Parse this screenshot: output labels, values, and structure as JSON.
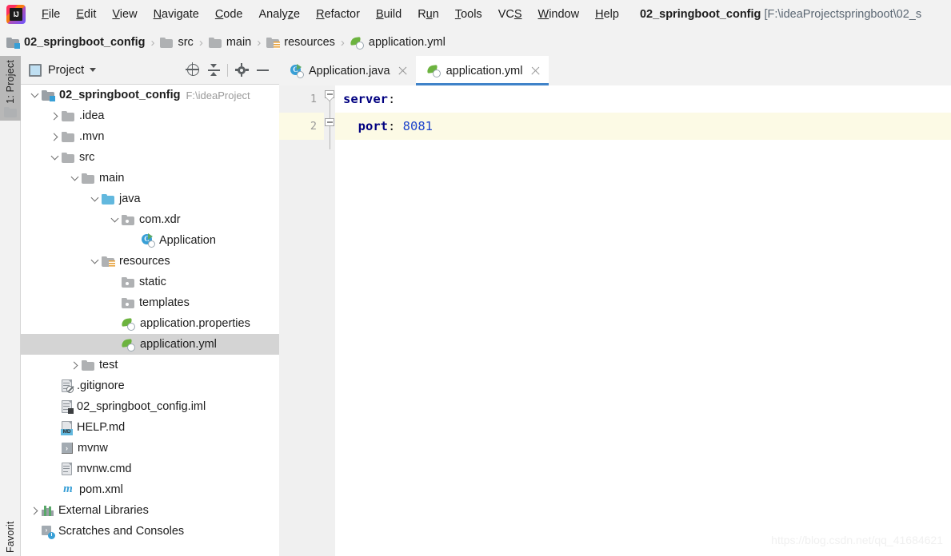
{
  "window": {
    "title_name": "02_springboot_config",
    "title_path": "[F:\\ideaProjectspringboot\\02_s",
    "logo_icon": "intellij-idea-logo"
  },
  "menubar": {
    "items": [
      {
        "label": "File",
        "mnemonic": "F"
      },
      {
        "label": "Edit",
        "mnemonic": "E"
      },
      {
        "label": "View",
        "mnemonic": "V"
      },
      {
        "label": "Navigate",
        "mnemonic": "N"
      },
      {
        "label": "Code",
        "mnemonic": "C"
      },
      {
        "label": "Analyze",
        "mnemonic": "z"
      },
      {
        "label": "Refactor",
        "mnemonic": "R"
      },
      {
        "label": "Build",
        "mnemonic": "B"
      },
      {
        "label": "Run",
        "mnemonic": "u"
      },
      {
        "label": "Tools",
        "mnemonic": "T"
      },
      {
        "label": "VCS",
        "mnemonic": "S"
      },
      {
        "label": "Window",
        "mnemonic": "W"
      },
      {
        "label": "Help",
        "mnemonic": "H"
      }
    ]
  },
  "breadcrumb": {
    "items": [
      {
        "label": "02_springboot_config",
        "icon": "module-folder-icon",
        "bold": true
      },
      {
        "label": "src",
        "icon": "folder-icon",
        "bold": false
      },
      {
        "label": "main",
        "icon": "folder-icon",
        "bold": false
      },
      {
        "label": "resources",
        "icon": "resources-folder-icon",
        "bold": false
      },
      {
        "label": "application.yml",
        "icon": "yml-file-icon",
        "bold": false
      }
    ],
    "separator": "›"
  },
  "toolstrip": {
    "project_label": "1: Project",
    "project_icon": "folder-icon",
    "favorites_label": "Favorites"
  },
  "project_panel": {
    "title": "Project",
    "title_icon": "project-view-icon",
    "dropdown_icon": "chevron-down-icon",
    "tools": [
      {
        "name": "locate-in-tree-icon",
        "label": "Select Opened File"
      },
      {
        "name": "collapse-all-icon",
        "label": "Collapse All"
      },
      {
        "name": "gear-icon",
        "label": "Settings"
      },
      {
        "name": "minimize-icon",
        "label": "Hide"
      }
    ],
    "tree": [
      {
        "label": "02_springboot_config",
        "path": "F:\\ideaProject",
        "icon": "module-folder-icon",
        "indent": 0,
        "arrow": "down",
        "bold": true,
        "selected": false
      },
      {
        "label": ".idea",
        "icon": "folder-icon",
        "indent": 1,
        "arrow": "right",
        "bold": false,
        "selected": false
      },
      {
        "label": ".mvn",
        "icon": "folder-icon",
        "indent": 1,
        "arrow": "right",
        "bold": false,
        "selected": false
      },
      {
        "label": "src",
        "icon": "folder-icon",
        "indent": 1,
        "arrow": "down",
        "bold": false,
        "selected": false
      },
      {
        "label": "main",
        "icon": "folder-icon",
        "indent": 2,
        "arrow": "down",
        "bold": false,
        "selected": false
      },
      {
        "label": "java",
        "icon": "source-root-folder-icon",
        "indent": 3,
        "arrow": "down",
        "bold": false,
        "selected": false
      },
      {
        "label": "com.xdr",
        "icon": "package-icon",
        "indent": 4,
        "arrow": "down",
        "bold": false,
        "selected": false
      },
      {
        "label": "Application",
        "icon": "java-class-runnable-icon",
        "indent": 5,
        "arrow": "none",
        "bold": false,
        "selected": false
      },
      {
        "label": "resources",
        "icon": "resources-folder-icon",
        "indent": 3,
        "arrow": "down",
        "bold": false,
        "selected": false
      },
      {
        "label": "static",
        "icon": "package-icon",
        "indent": 4,
        "arrow": "none",
        "bold": false,
        "selected": false
      },
      {
        "label": "templates",
        "icon": "package-icon",
        "indent": 4,
        "arrow": "none",
        "bold": false,
        "selected": false
      },
      {
        "label": "application.properties",
        "icon": "yml-file-icon",
        "indent": 4,
        "arrow": "none",
        "bold": false,
        "selected": false
      },
      {
        "label": "application.yml",
        "icon": "yml-file-icon",
        "indent": 4,
        "arrow": "none",
        "bold": false,
        "selected": true
      },
      {
        "label": "test",
        "icon": "folder-icon",
        "indent": 2,
        "arrow": "right",
        "bold": false,
        "selected": false
      },
      {
        "label": ".gitignore",
        "icon": "gitignore-file-icon",
        "indent": 1,
        "arrow": "none",
        "bold": false,
        "selected": false
      },
      {
        "label": "02_springboot_config.iml",
        "icon": "iml-file-icon",
        "indent": 1,
        "arrow": "none",
        "bold": false,
        "selected": false
      },
      {
        "label": "HELP.md",
        "icon": "markdown-file-icon",
        "indent": 1,
        "arrow": "none",
        "bold": false,
        "selected": false
      },
      {
        "label": "mvnw",
        "icon": "shell-script-icon",
        "indent": 1,
        "arrow": "none",
        "bold": false,
        "selected": false
      },
      {
        "label": "mvnw.cmd",
        "icon": "text-file-icon",
        "indent": 1,
        "arrow": "none",
        "bold": false,
        "selected": false
      },
      {
        "label": "pom.xml",
        "icon": "maven-file-icon",
        "indent": 1,
        "arrow": "none",
        "bold": false,
        "selected": false
      },
      {
        "label": "External Libraries",
        "icon": "external-libraries-icon",
        "indent": 0,
        "arrow": "right",
        "bold": false,
        "selected": false
      },
      {
        "label": "Scratches and Consoles",
        "icon": "scratches-icon",
        "indent": 0,
        "arrow": "none",
        "bold": false,
        "selected": false
      }
    ]
  },
  "editor": {
    "tabs": [
      {
        "label": "Application.java",
        "icon": "java-class-runnable-icon",
        "active": false
      },
      {
        "label": "application.yml",
        "icon": "yml-file-icon",
        "active": true
      }
    ],
    "close_icon": "close-icon",
    "gutter_lines": [
      "1",
      "2"
    ],
    "code": [
      {
        "line": 1,
        "highlight": false,
        "tokens": [
          {
            "text": "server",
            "type": "key"
          },
          {
            "text": ":",
            "type": "punct"
          }
        ]
      },
      {
        "line": 2,
        "highlight": true,
        "tokens": [
          {
            "text": "  port",
            "type": "key"
          },
          {
            "text": ": ",
            "type": "punct"
          },
          {
            "text": "8081",
            "type": "num"
          }
        ]
      }
    ]
  },
  "watermark": {
    "text": "https://blog.csdn.net/qq_41684621"
  },
  "colors": {
    "accent": "#4083c9",
    "selection": "#d4d4d4",
    "line_highlight": "#fcfae5",
    "keyword": "#000080",
    "number": "#1f45cc",
    "panel_bg": "#f2f2f2",
    "gutter_bg": "#f0f0f0"
  }
}
